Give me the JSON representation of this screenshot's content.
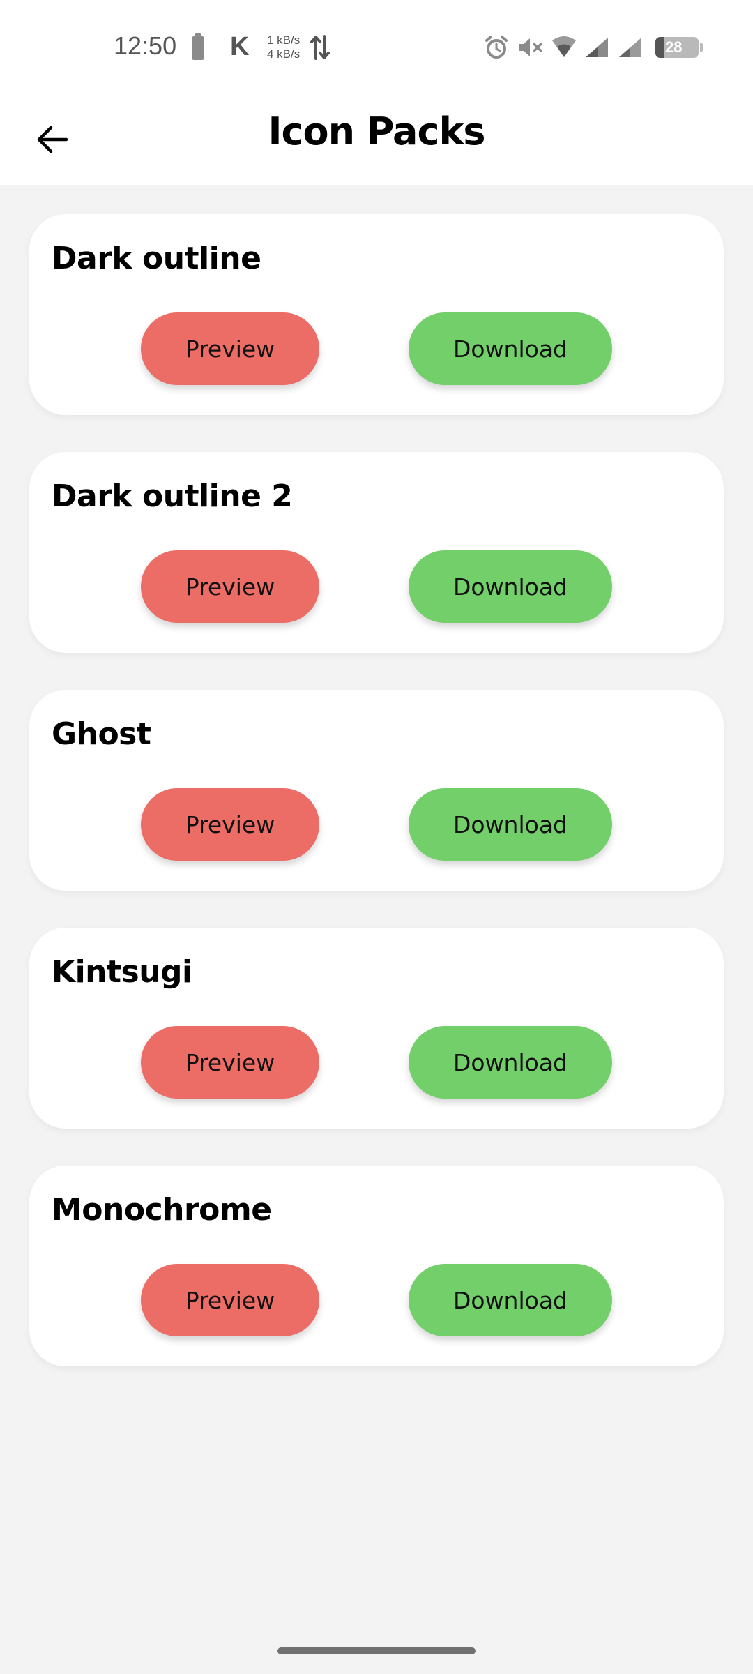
{
  "status_bar": {
    "time": "12:50",
    "speed_up": "1 kB/s",
    "speed_down": "4 kB/s",
    "carrier_glyph": "K",
    "battery_level": "28",
    "icons": [
      "battery-saver-icon",
      "alarm-icon",
      "mute-icon",
      "wifi-icon",
      "signal-icon",
      "signal-icon-2",
      "battery-icon"
    ]
  },
  "header": {
    "title": "Icon Packs",
    "back_icon": "arrow-left-icon"
  },
  "icon_packs": [
    {
      "name": "Dark outline",
      "preview_label": "Preview",
      "download_label": "Download"
    },
    {
      "name": "Dark outline 2",
      "preview_label": "Preview",
      "download_label": "Download"
    },
    {
      "name": "Ghost",
      "preview_label": "Preview",
      "download_label": "Download"
    },
    {
      "name": "Kintsugi",
      "preview_label": "Preview",
      "download_label": "Download"
    },
    {
      "name": "Monochrome",
      "preview_label": "Preview",
      "download_label": "Download"
    }
  ],
  "colors": {
    "preview_button": "#ec6c66",
    "download_button": "#72cf6a",
    "background": "#f3f3f3",
    "card": "#ffffff"
  }
}
